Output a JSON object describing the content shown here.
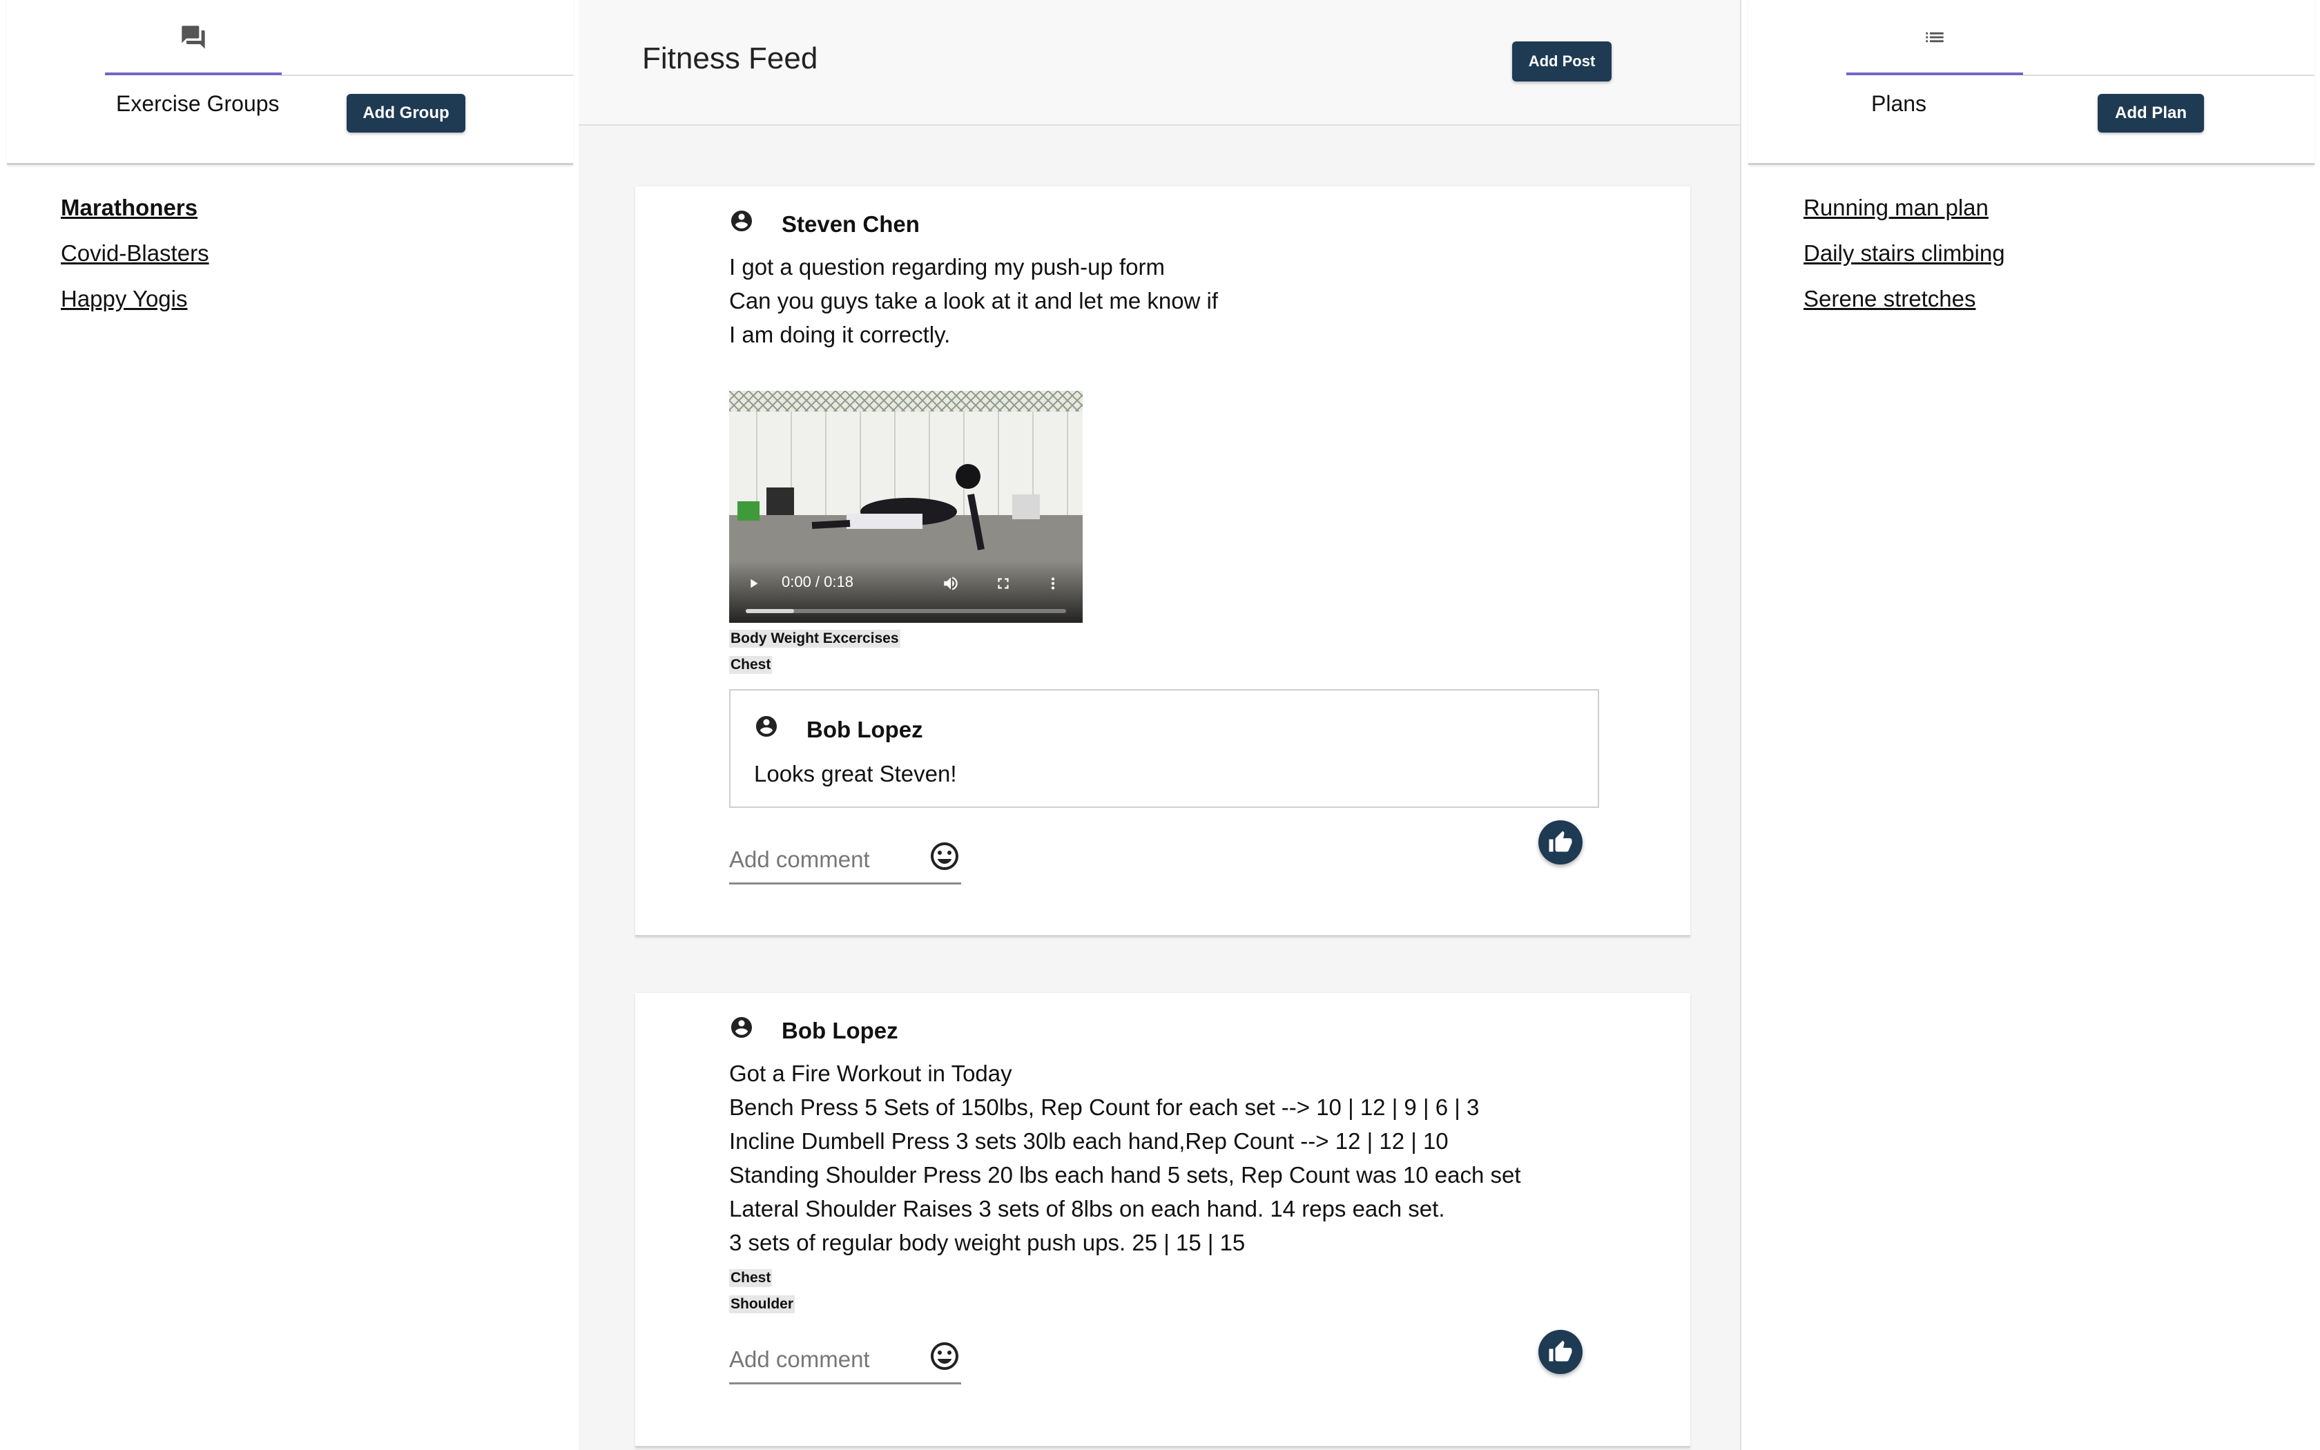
{
  "left_sidebar": {
    "tab_icon": "forum-icon",
    "heading": "Exercise Groups",
    "add_button": "Add Group",
    "groups": [
      {
        "label": "Marathoners",
        "active": true
      },
      {
        "label": "Covid-Blasters",
        "active": false
      },
      {
        "label": "Happy Yogis",
        "active": false
      }
    ]
  },
  "feed": {
    "title": "Fitness Feed",
    "add_post_button": "Add Post",
    "posts": [
      {
        "author": "Steven Chen",
        "body": "I got a question regarding my push-up form\nCan you guys take a look at it and let me know if\nI am doing it correctly.",
        "video": {
          "time": "0:00 / 0:18",
          "progress": 0.15
        },
        "tags": [
          "Body Weight Excercises",
          "Chest"
        ],
        "comments": [
          {
            "author": "Bob Lopez",
            "text": "Looks great Steven!"
          }
        ],
        "comment_placeholder": "Add comment"
      },
      {
        "author": "Bob Lopez",
        "body": "Got a Fire Workout in Today\nBench Press 5 Sets of 150lbs, Rep Count for each set --> 10 | 12 | 9 | 6 | 3\nIncline Dumbell Press 3 sets 30lb each hand,Rep Count --> 12 | 12 | 10\nStanding Shoulder Press 20 lbs each hand 5 sets, Rep Count was 10 each set\nLateral Shoulder Raises 3 sets of 8lbs on each hand. 14 reps each set.\n3 sets of regular body weight push ups. 25 | 15 | 15",
        "tags": [
          "Chest",
          "Shoulder"
        ],
        "comment_placeholder": "Add comment"
      }
    ]
  },
  "right_sidebar": {
    "tab_icon": "list-icon",
    "heading": "Plans",
    "add_button": "Add Plan",
    "plans": [
      {
        "label": "Running man plan"
      },
      {
        "label": "Daily stairs climbing"
      },
      {
        "label": "Serene stretches"
      }
    ]
  },
  "colors": {
    "accent_underline": "#7266c8",
    "button_dark": "#1f3a53",
    "feed_background": "#f5f5f5"
  }
}
